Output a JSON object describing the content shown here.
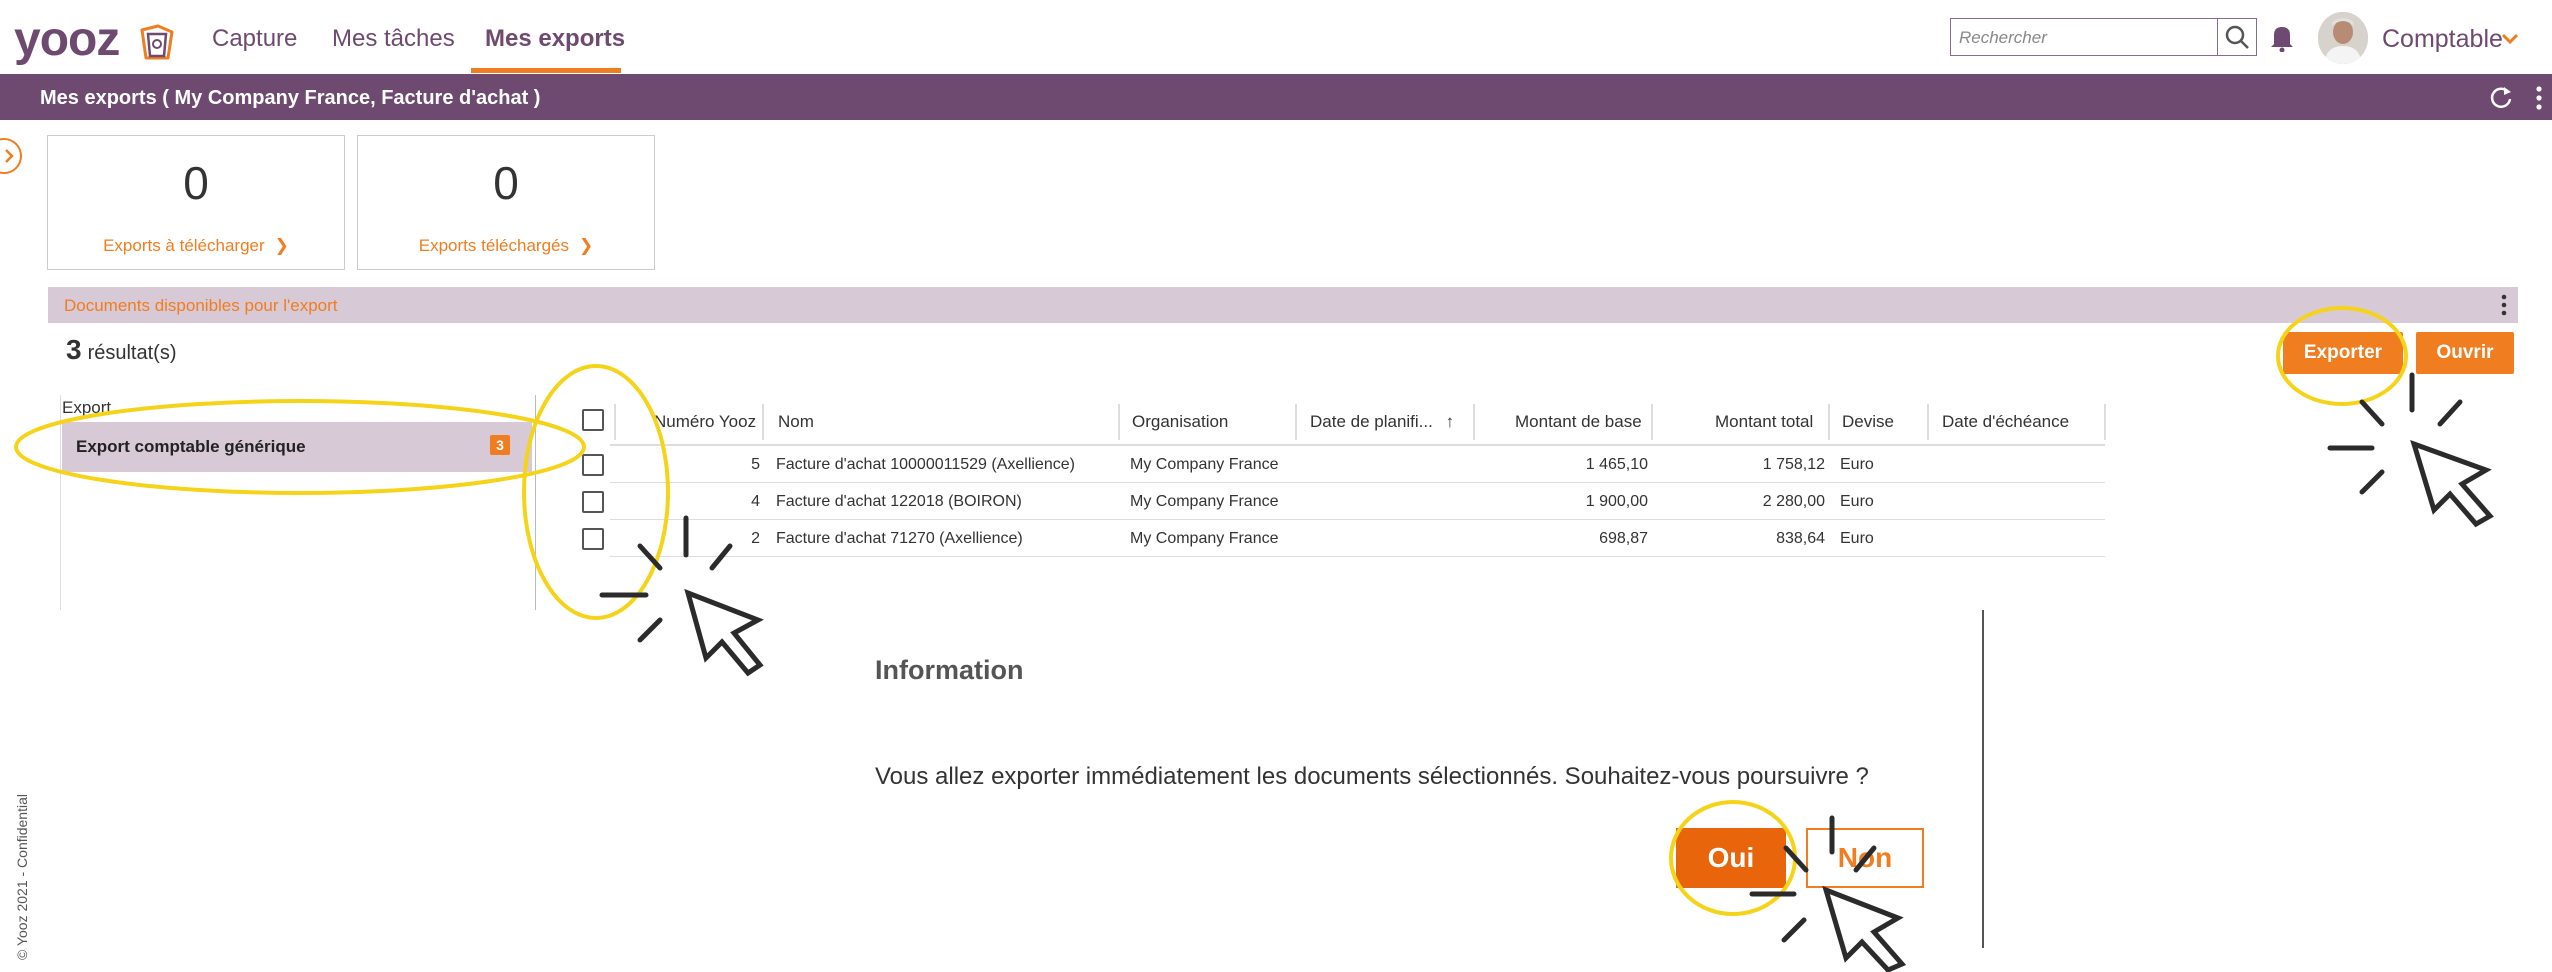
{
  "app": {
    "logo_text": "yooz",
    "nav": [
      "Capture",
      "Mes tâches",
      "Mes exports"
    ],
    "search_placeholder": "Rechercher",
    "user_label": "Comptable",
    "brand_color": "#6e4a70",
    "accent_color": "#f07d1f"
  },
  "page": {
    "title": "Mes exports ( My Company France, Facture d'achat )"
  },
  "stats": [
    {
      "value": "0",
      "link": "Exports à télécharger"
    },
    {
      "value": "0",
      "link": "Exports téléchargés"
    }
  ],
  "documents": {
    "section_title": "Documents disponibles pour l'export",
    "results_count": "3",
    "results_label": "résultat(s)",
    "export_button": "Exporter",
    "open_button": "Ouvrir",
    "export_label": "Export",
    "export_item": {
      "label": "Export comptable générique",
      "count": "3"
    },
    "columns": [
      "Numéro Yooz",
      "Nom",
      "Organisation",
      "Date de planifi...",
      "Montant de base",
      "Montant total",
      "Devise",
      "Date d'échéance"
    ],
    "rows": [
      {
        "num": "5",
        "nom": "Facture d'achat 10000011529 (Axellience)",
        "org": "My Company France",
        "base": "1 465,10",
        "total": "1 758,12",
        "devise": "Euro"
      },
      {
        "num": "4",
        "nom": "Facture d'achat 122018 (BOIRON)",
        "org": "My Company France",
        "base": "1 900,00",
        "total": "2 280,00",
        "devise": "Euro"
      },
      {
        "num": "2",
        "nom": "Facture d'achat 71270 (Axellience)",
        "org": "My Company France",
        "base": "698,87",
        "total": "838,64",
        "devise": "Euro"
      }
    ]
  },
  "dialog": {
    "title": "Information",
    "message": "Vous allez exporter immédiatement les documents sélectionnés. Souhaitez-vous poursuivre ?",
    "yes": "Oui",
    "no": "Non"
  },
  "footer": {
    "copyright": "© Yooz 2021 - Confidential"
  },
  "icons": [
    "yooz-logo-icon",
    "search-icon",
    "bell-icon",
    "avatar",
    "chevron-down-icon",
    "refresh-icon",
    "more-vertical-icon",
    "chevron-right-icon",
    "sort-up-icon",
    "cursor-icon"
  ]
}
